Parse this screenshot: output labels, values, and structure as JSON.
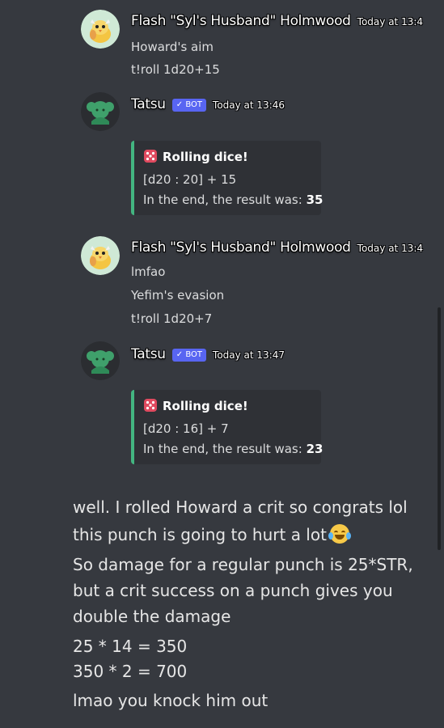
{
  "messages": [
    {
      "username": "Flash \"Syl's Husband\" Holmwood",
      "timestamp": "Today at 13:4",
      "lines": [
        "Howard's aim",
        "t!roll 1d20+15"
      ]
    },
    {
      "username": "Tatsu",
      "bot_tag": "✓ BOT",
      "timestamp": "Today at 13:46",
      "embed": {
        "title": "Rolling dice!",
        "roll": "[d20 : 20] + 15",
        "result_prefix": "In the end, the result was: ",
        "result_value": "35"
      }
    },
    {
      "username": "Flash \"Syl's Husband\" Holmwood",
      "timestamp": "Today at 13:4",
      "lines": [
        "lmfao",
        "Yefim's evasion",
        "t!roll 1d20+7"
      ]
    },
    {
      "username": "Tatsu",
      "bot_tag": "✓ BOT",
      "timestamp": "Today at 13:47",
      "embed": {
        "title": "Rolling dice!",
        "roll": "[d20 : 16] + 7",
        "result_prefix": "In the end, the result was: ",
        "result_value": "23"
      }
    }
  ],
  "narration": [
    "well. I rolled Howard a crit so congrats lol",
    "this punch is going to hurt a lot",
    "So damage for a regular punch is 25*STR,",
    "but a crit success on a punch gives you",
    "double the damage",
    "25 * 14 = 350",
    "350 * 2 = 700",
    "lmao you knock him out"
  ],
  "icons": {
    "flash_avatar": "bird-avatar-icon",
    "tatsu_avatar": "tatsu-avatar-icon",
    "dice": "dice-icon",
    "emoji": "joy-tears-emoji-icon"
  },
  "colors": {
    "background": "#36393f",
    "embed_bg": "#2f3136",
    "embed_accent": "#43b581",
    "bot_tag": "#5865f2"
  }
}
